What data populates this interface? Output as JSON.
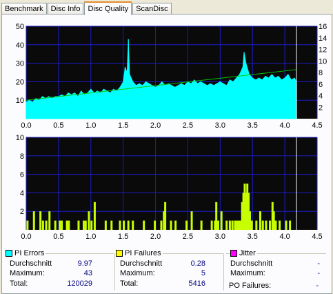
{
  "tabs": [
    {
      "label": "Benchmark",
      "active": false
    },
    {
      "label": "Disc Info",
      "active": false
    },
    {
      "label": "Disc Quality",
      "active": true
    },
    {
      "label": "ScanDisc",
      "active": false
    }
  ],
  "colors": {
    "plot_bg": "#0a0a0a",
    "grid": "#1c1cc8",
    "pie": "#00ffff",
    "pif": "#c8ff00",
    "speed": "#00c800",
    "marker": "#ffffff"
  },
  "chart_data": [
    {
      "type": "area",
      "name": "pi-errors-chart",
      "xlim": [
        0,
        4.5
      ],
      "ylim": [
        0,
        50
      ],
      "y2lim": [
        0,
        16
      ],
      "x_ticks": [
        "0.0",
        "0.5",
        "1.0",
        "1.5",
        "2.0",
        "2.5",
        "3.0",
        "3.5",
        "4.0",
        "4.5"
      ],
      "y_ticks": [
        "10",
        "20",
        "30",
        "40",
        "50"
      ],
      "y2_ticks": [
        "2",
        "4",
        "6",
        "8",
        "10",
        "12",
        "14",
        "16"
      ],
      "x_end": 4.18,
      "marker_x": 4.18,
      "speed_line": {
        "x": [
          0.0,
          4.18
        ],
        "y2": [
          3.2,
          8.5
        ]
      },
      "series": [
        {
          "points": [
            [
              0.0,
              9
            ],
            [
              0.05,
              10
            ],
            [
              0.1,
              9
            ],
            [
              0.15,
              11
            ],
            [
              0.2,
              10
            ],
            [
              0.25,
              12
            ],
            [
              0.3,
              11
            ],
            [
              0.35,
              12
            ],
            [
              0.4,
              11
            ],
            [
              0.45,
              12
            ],
            [
              0.5,
              12
            ],
            [
              0.55,
              13
            ],
            [
              0.6,
              12
            ],
            [
              0.65,
              14
            ],
            [
              0.7,
              13
            ],
            [
              0.75,
              14
            ],
            [
              0.8,
              12
            ],
            [
              0.85,
              15
            ],
            [
              0.9,
              13
            ],
            [
              0.95,
              14
            ],
            [
              1.0,
              16
            ],
            [
              1.05,
              14
            ],
            [
              1.1,
              15
            ],
            [
              1.15,
              14
            ],
            [
              1.2,
              16
            ],
            [
              1.25,
              15
            ],
            [
              1.3,
              14
            ],
            [
              1.35,
              16
            ],
            [
              1.4,
              15
            ],
            [
              1.45,
              17
            ],
            [
              1.5,
              20
            ],
            [
              1.53,
              28
            ],
            [
              1.56,
              25
            ],
            [
              1.58,
              43
            ],
            [
              1.6,
              24
            ],
            [
              1.65,
              20
            ],
            [
              1.7,
              18
            ],
            [
              1.75,
              19
            ],
            [
              1.8,
              18
            ],
            [
              1.85,
              20
            ],
            [
              1.9,
              19
            ],
            [
              1.95,
              18
            ],
            [
              2.0,
              17
            ],
            [
              2.05,
              18
            ],
            [
              2.1,
              20
            ],
            [
              2.15,
              18
            ],
            [
              2.2,
              19
            ],
            [
              2.25,
              18
            ],
            [
              2.3,
              17
            ],
            [
              2.35,
              18
            ],
            [
              2.4,
              19
            ],
            [
              2.45,
              18
            ],
            [
              2.5,
              20
            ],
            [
              2.55,
              19
            ],
            [
              2.6,
              21
            ],
            [
              2.65,
              19
            ],
            [
              2.7,
              20
            ],
            [
              2.75,
              19
            ],
            [
              2.8,
              18
            ],
            [
              2.85,
              19
            ],
            [
              2.9,
              18
            ],
            [
              2.95,
              19
            ],
            [
              3.0,
              20
            ],
            [
              3.05,
              19
            ],
            [
              3.1,
              18
            ],
            [
              3.15,
              21
            ],
            [
              3.2,
              20
            ],
            [
              3.25,
              22
            ],
            [
              3.3,
              24
            ],
            [
              3.35,
              28
            ],
            [
              3.37,
              36
            ],
            [
              3.4,
              30
            ],
            [
              3.45,
              24
            ],
            [
              3.5,
              22
            ],
            [
              3.55,
              21
            ],
            [
              3.6,
              22
            ],
            [
              3.65,
              21
            ],
            [
              3.7,
              23
            ],
            [
              3.75,
              22
            ],
            [
              3.8,
              24
            ],
            [
              3.85,
              22
            ],
            [
              3.9,
              23
            ],
            [
              3.95,
              21
            ],
            [
              4.0,
              22
            ],
            [
              4.05,
              24
            ],
            [
              4.1,
              21
            ],
            [
              4.15,
              22
            ],
            [
              4.18,
              20
            ]
          ]
        }
      ]
    },
    {
      "type": "bar",
      "name": "pi-failures-chart",
      "xlim": [
        0,
        4.5
      ],
      "ylim": [
        0,
        10
      ],
      "x_ticks": [
        "0.0",
        "0.5",
        "1.0",
        "1.5",
        "2.0",
        "2.5",
        "3.0",
        "3.5",
        "4.0",
        "4.5"
      ],
      "y_ticks": [
        "2",
        "4",
        "6",
        "8",
        "10"
      ],
      "marker_x": 4.18,
      "series": [
        {
          "points": [
            [
              0.02,
              1
            ],
            [
              0.12,
              2
            ],
            [
              0.22,
              2
            ],
            [
              0.26,
              1
            ],
            [
              0.31,
              1
            ],
            [
              0.36,
              2
            ],
            [
              0.45,
              1
            ],
            [
              0.52,
              1
            ],
            [
              0.55,
              1
            ],
            [
              0.63,
              1
            ],
            [
              0.66,
              1
            ],
            [
              0.81,
              1
            ],
            [
              0.89,
              1
            ],
            [
              0.92,
              1
            ],
            [
              0.97,
              2
            ],
            [
              1.01,
              1
            ],
            [
              1.06,
              3
            ],
            [
              1.23,
              1
            ],
            [
              1.32,
              1
            ],
            [
              1.45,
              1
            ],
            [
              1.51,
              1
            ],
            [
              1.58,
              1
            ],
            [
              1.65,
              1
            ],
            [
              1.82,
              1
            ],
            [
              1.99,
              1
            ],
            [
              2.09,
              1
            ],
            [
              2.13,
              2
            ],
            [
              2.15,
              3
            ],
            [
              2.24,
              1
            ],
            [
              2.31,
              1
            ],
            [
              2.48,
              1
            ],
            [
              2.56,
              2
            ],
            [
              2.71,
              1
            ],
            [
              2.87,
              1
            ],
            [
              2.92,
              1
            ],
            [
              2.94,
              3
            ],
            [
              2.97,
              1
            ],
            [
              3.02,
              2
            ],
            [
              3.1,
              1
            ],
            [
              3.15,
              1
            ],
            [
              3.19,
              1
            ],
            [
              3.23,
              1
            ],
            [
              3.26,
              1
            ],
            [
              3.29,
              1
            ],
            [
              3.32,
              1
            ],
            [
              3.34,
              3
            ],
            [
              3.36,
              4
            ],
            [
              3.38,
              5
            ],
            [
              3.4,
              4
            ],
            [
              3.42,
              5
            ],
            [
              3.44,
              4
            ],
            [
              3.46,
              2
            ],
            [
              3.49,
              1
            ],
            [
              3.56,
              1
            ],
            [
              3.62,
              2
            ],
            [
              3.66,
              1
            ],
            [
              3.71,
              1
            ],
            [
              3.77,
              1
            ],
            [
              3.81,
              3
            ],
            [
              3.83,
              2
            ],
            [
              3.86,
              1
            ],
            [
              3.92,
              1
            ],
            [
              4.02,
              1
            ],
            [
              4.08,
              1
            ]
          ]
        }
      ]
    }
  ],
  "stats": {
    "pi_errors": {
      "title": "PI Errors",
      "color": "#00ffff",
      "avg_label": "Durchschnitt",
      "avg": "9.97",
      "max_label": "Maximum:",
      "max": "43",
      "total_label": "Total:",
      "total": "120029"
    },
    "pi_failures": {
      "title": "PI Failures",
      "color": "#ffff00",
      "avg_label": "Durchschnitt",
      "avg": "0.28",
      "max_label": "Maximum:",
      "max": "5",
      "total_label": "Total:",
      "total": "5416"
    },
    "jitter": {
      "title": "Jitter",
      "color": "#ff00ff",
      "avg_label": "Durchschnitt",
      "avg": "-",
      "max_label": "Maximum:",
      "max": "-",
      "po_label": "PO Failures:",
      "po": "-"
    }
  }
}
